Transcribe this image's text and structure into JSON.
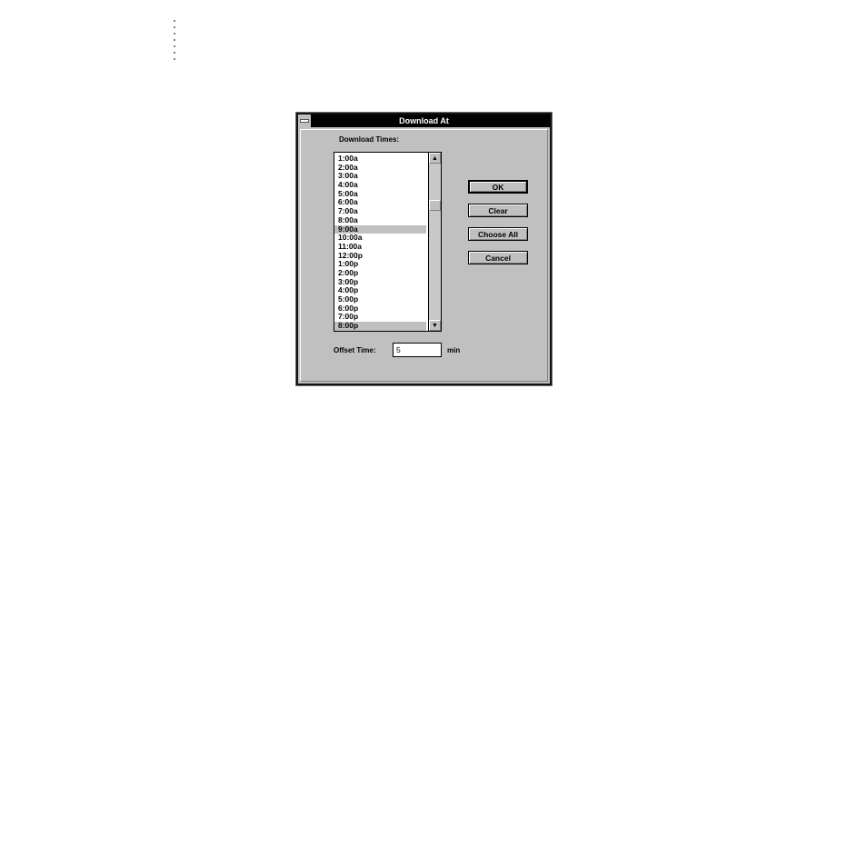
{
  "dialog": {
    "title": "Download At",
    "download_times_label": "Download Times:",
    "times": [
      {
        "label": "1:00a",
        "selected": false
      },
      {
        "label": "2:00a",
        "selected": false
      },
      {
        "label": "3:00a",
        "selected": false
      },
      {
        "label": "4:00a",
        "selected": false
      },
      {
        "label": "5:00a",
        "selected": false
      },
      {
        "label": "6:00a",
        "selected": false
      },
      {
        "label": "7:00a",
        "selected": false
      },
      {
        "label": "8:00a",
        "selected": false
      },
      {
        "label": "9:00a",
        "selected": true
      },
      {
        "label": "10:00a",
        "selected": false
      },
      {
        "label": "11:00a",
        "selected": false
      },
      {
        "label": "12:00p",
        "selected": false
      },
      {
        "label": "1:00p",
        "selected": false
      },
      {
        "label": "2:00p",
        "selected": false
      },
      {
        "label": "3:00p",
        "selected": false
      },
      {
        "label": "4:00p",
        "selected": false
      },
      {
        "label": "5:00p",
        "selected": false
      },
      {
        "label": "6:00p",
        "selected": false
      },
      {
        "label": "7:00p",
        "selected": false
      },
      {
        "label": "8:00p",
        "selected": true
      }
    ],
    "buttons": {
      "ok": "OK",
      "clear": "Clear",
      "choose_all": "Choose All",
      "cancel": "Cancel"
    },
    "offset_label": "Offset Time:",
    "offset_value": "5",
    "offset_unit": "min"
  },
  "icons": {
    "scroll_up": "▲",
    "scroll_down": "▼"
  },
  "colors": {
    "titlebar": "#000000",
    "dialog_face": "#c0c0c0",
    "selection": "#c0c0c0"
  }
}
